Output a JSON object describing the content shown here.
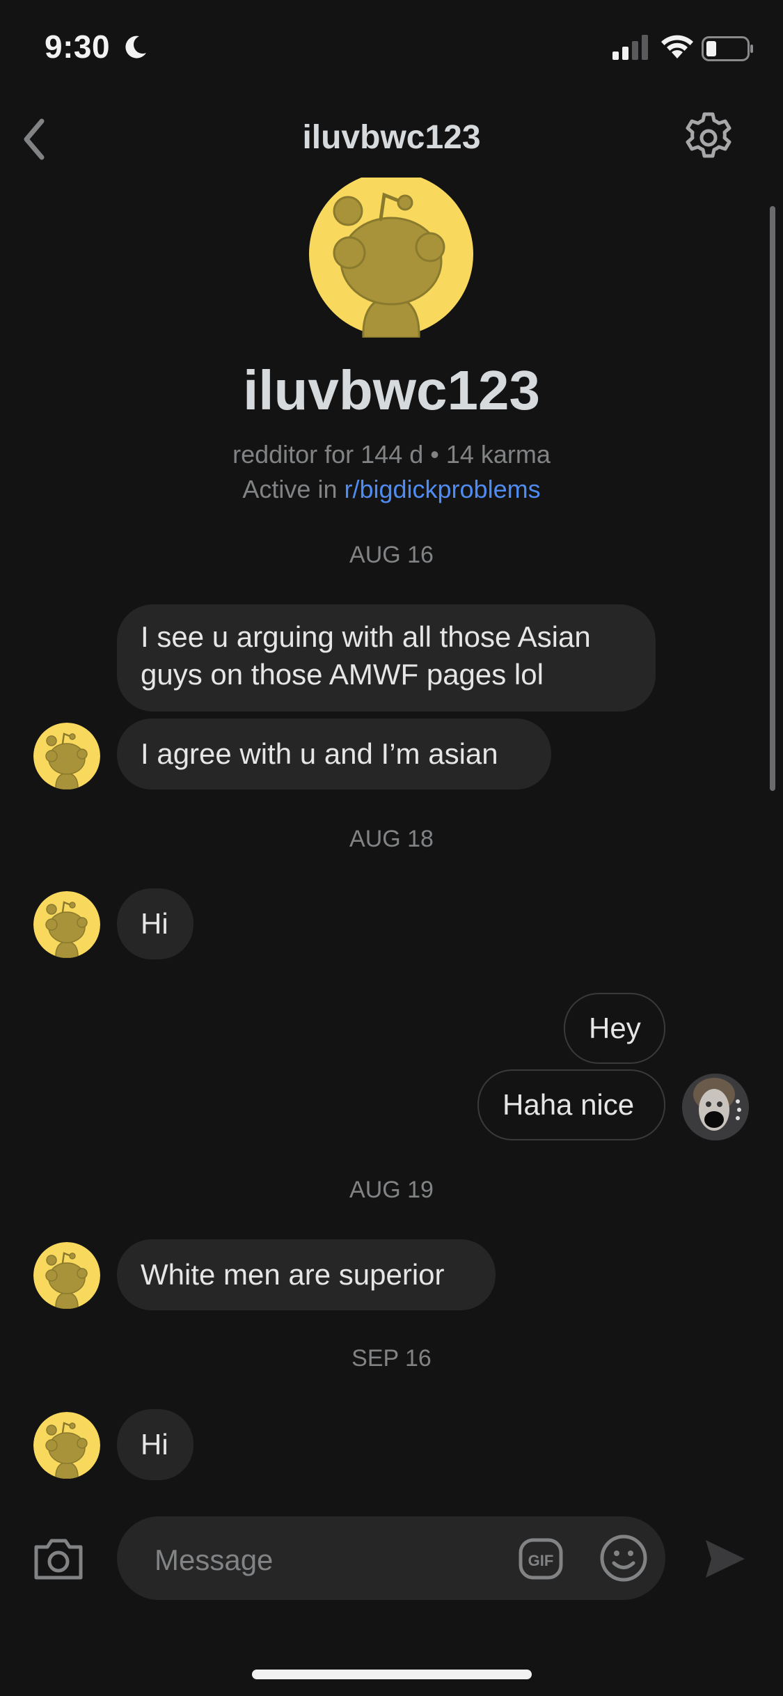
{
  "status_bar": {
    "time": "9:30"
  },
  "header": {
    "title": "iluvbwc123"
  },
  "profile": {
    "username": "iluvbwc123",
    "meta": "redditor for 144 d • 14 karma",
    "active_prefix": "Active in ",
    "active_link": "r/bigdickproblems"
  },
  "messages": {
    "date_1": "AUG 16",
    "msg_1": "I see u arguing with all those Asian guys on those AMWF pages lol",
    "msg_2": "I agree with u and I’m asian",
    "date_2": "AUG 18",
    "msg_3": "Hi",
    "msg_4": "Hey",
    "msg_5": "Haha nice",
    "date_3": "AUG 19",
    "msg_6": "White men are superior",
    "date_4": "SEP 16",
    "msg_7": "Hi"
  },
  "composer": {
    "placeholder": "Message",
    "gif_label": "GIF"
  },
  "colors": {
    "background": "#131314",
    "bubble": "#262627",
    "link": "#4f8cf1",
    "snoo_yellow": "#f9d95d"
  },
  "icons": [
    "moon-icon",
    "signal-icon",
    "wifi-icon",
    "battery-icon",
    "back-chevron-icon",
    "gear-icon",
    "camera-icon",
    "gif-icon",
    "emoji-icon",
    "send-icon"
  ]
}
